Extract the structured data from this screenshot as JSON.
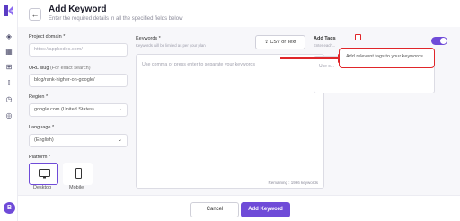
{
  "header": {
    "title": "Add Keyword",
    "subtitle": "Enter the required details in all the specified fields below"
  },
  "form": {
    "project_domain_label": "Project domain *",
    "project_domain_placeholder": "https://appkodes.com/",
    "url_slug_label": "URL slug",
    "url_slug_hint": "(For exact search)",
    "url_slug_value": "blog/rank-higher-on-google/",
    "region_label": "Region *",
    "region_value": "google.com (United States)",
    "language_label": "Language *",
    "language_value": "(English)",
    "platform_label": "Platform *",
    "platforms": [
      {
        "label": "Desktop",
        "icon": "desktop-icon",
        "selected": true
      },
      {
        "label": "Mobile",
        "icon": "mobile-icon",
        "selected": false
      }
    ],
    "keywords_label": "Keywords *",
    "keywords_hint": "Keywords will be limited as per your plan",
    "keywords_placeholder": "Use comma or press enter to separate your keywords",
    "csv_button": "CSV or Text",
    "remaining": "Remaining : 1996 keywords",
    "add_tags_label": "Add Tags",
    "add_tags_hint": "Enter each...",
    "tags_placeholder": "Use c...",
    "tags_tooltip": "Add relevent tags to your keywords",
    "tags_toggle_on": true
  },
  "footer": {
    "cancel_label": "Cancel",
    "add_label": "Add Keyword"
  },
  "user": {
    "avatar_initial": "B"
  },
  "colors": {
    "accent": "#6f4bd8",
    "highlight": "#e0262a"
  }
}
